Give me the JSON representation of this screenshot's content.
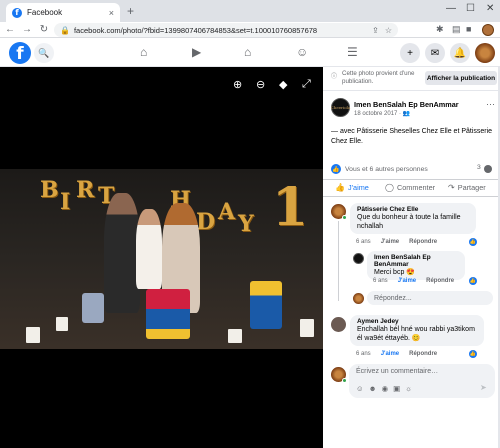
{
  "browser": {
    "tab_title": "Facebook",
    "tab_close": "×",
    "new_tab": "+",
    "controls": {
      "minimize": "—",
      "maximize": "☐",
      "close": "✕"
    },
    "nav": {
      "back": "←",
      "forward": "→",
      "reload": "↻"
    },
    "url": "facebook.com/photo/?fbid=1399807406784853&set=t.100010760857678"
  },
  "fb_header": {
    "logo": "f",
    "nav_icons": [
      "home-icon",
      "watch-icon",
      "marketplace-icon",
      "groups-icon",
      "menu-icon"
    ],
    "right_icons": [
      "create-icon",
      "messenger-icon",
      "notifications-icon"
    ]
  },
  "viewer_tools": [
    "zoom-in-icon",
    "zoom-out-icon",
    "tag-icon",
    "fullscreen-icon"
  ],
  "photo": {
    "balloons": [
      "B",
      "I",
      "R",
      "T",
      "H",
      "D",
      "A",
      "Y",
      "1"
    ]
  },
  "notice": {
    "text": "Cette photo provient d'une publication.",
    "button": "Afficher la publication"
  },
  "post": {
    "author_avatar_text": "Cheeriola",
    "author": "Imen BenSalah Ep BenAmmar",
    "date": "18 octobre 2017 · ",
    "caption": "— avec Pâtisserie Sheselles Chez Elle et Pâtisserie Chez Elle.",
    "reactions_text": "Vous et 6 autres personnes",
    "comment_count": "3"
  },
  "actions": {
    "like": "J'aime",
    "comment": "Commenter",
    "share": "Partager"
  },
  "comments": [
    {
      "name": "Pâtisserie Chez Elle",
      "text": "Que du bonheur à toute la famille nchallah",
      "age": "6 ans",
      "like": "J'aime",
      "reply": "Répondre"
    },
    {
      "name": "Imen BenSalah Ep BenAmmar",
      "text": "Merci bcp 😍",
      "age": "6 ans",
      "like": "J'aime",
      "reply": "Répondre"
    },
    {
      "name": "Aymen Jedey",
      "text": "Enchallah bél hné wou rabbi ya3tikom él wa9ét éttayéb. 😊",
      "age": "6 ans",
      "like": "J'aime",
      "reply": "Répondre"
    }
  ],
  "reply_placeholder": "Répondez...",
  "composer_placeholder": "Écrivez un commentaire…",
  "colors": {
    "facebook_blue": "#1877f2",
    "bubble": "#f0f2f5",
    "muted": "#65676b"
  }
}
